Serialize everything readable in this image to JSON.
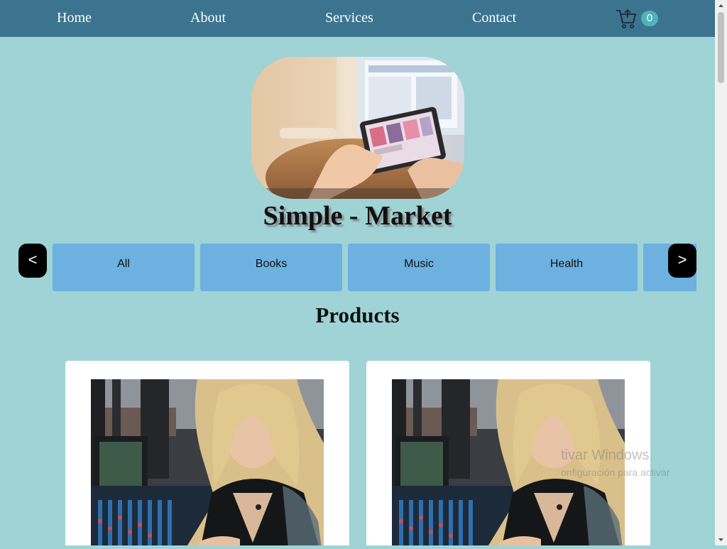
{
  "nav": {
    "links": [
      "Home",
      "About",
      "Services",
      "Contact"
    ],
    "cart_count": "0"
  },
  "hero": {
    "image": "tablet-shopping-photo",
    "title": "Simple - Market"
  },
  "categories": {
    "prev_label": "<",
    "next_label": ">",
    "items": [
      "All",
      "Books",
      "Music",
      "Health"
    ]
  },
  "products": {
    "heading": "Products",
    "cards": [
      {
        "image": "woman-at-mixing-console-photo"
      },
      {
        "image": "woman-at-mixing-console-photo"
      }
    ]
  },
  "watermark": {
    "title": "tivar Windows",
    "subtitle": "onfiguración para activar"
  },
  "colors": {
    "page_bg": "#9fd3d6",
    "nav_bg": "#3c7490",
    "category_bg": "#6cb1e0",
    "cart_badge": "#4fb3b8"
  }
}
